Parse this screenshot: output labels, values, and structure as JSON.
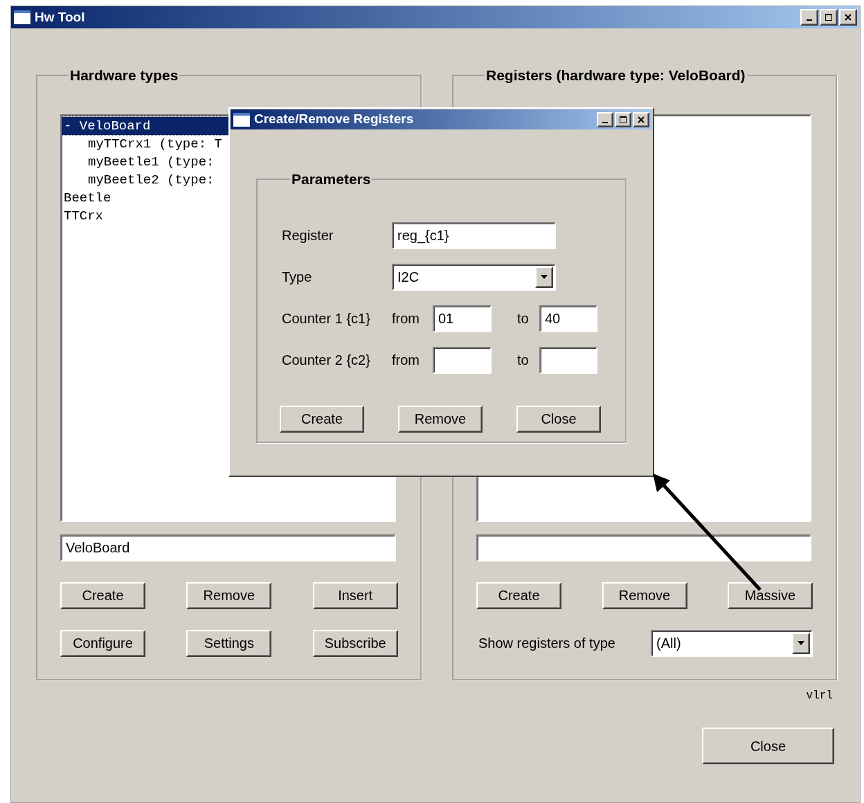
{
  "window": {
    "title": "Hw Tool"
  },
  "hardware_types": {
    "title": "Hardware types",
    "tree": [
      {
        "label": "VeloBoard",
        "expander": "-",
        "selected": true,
        "children": [
          {
            "label": "myTTCrx1 (type: T",
            "selected": false
          },
          {
            "label": "myBeetle1 (type:",
            "selected": false
          },
          {
            "label": "myBeetle2 (type:",
            "selected": false
          }
        ]
      },
      {
        "label": "Beetle",
        "selected": false
      },
      {
        "label": "TTCrx",
        "selected": false
      }
    ],
    "name_field": {
      "value": "VeloBoard"
    },
    "buttons": [
      "Create",
      "Remove",
      "Insert",
      "Configure",
      "Settings",
      "Subscribe"
    ]
  },
  "registers": {
    "title": "Registers (hardware type: VeloBoard)",
    "buttons": [
      "Create",
      "Remove",
      "Massive"
    ],
    "filter": {
      "label": "Show registers of type",
      "value": "(All)"
    }
  },
  "version": "vlrl",
  "close_button": "Close",
  "dialog": {
    "title": "Create/Remove Registers",
    "group": "Parameters",
    "register": {
      "label": "Register",
      "value": "reg_{c1}"
    },
    "type": {
      "label": "Type",
      "value": "I2C"
    },
    "counters": [
      {
        "label": "Counter 1 {c1}",
        "from_label": "from",
        "from": "01",
        "to_label": "to",
        "to": "40"
      },
      {
        "label": "Counter 2 {c2}",
        "from_label": "from",
        "to_label": "to"
      }
    ],
    "buttons": [
      "Create",
      "Remove",
      "Close"
    ]
  }
}
